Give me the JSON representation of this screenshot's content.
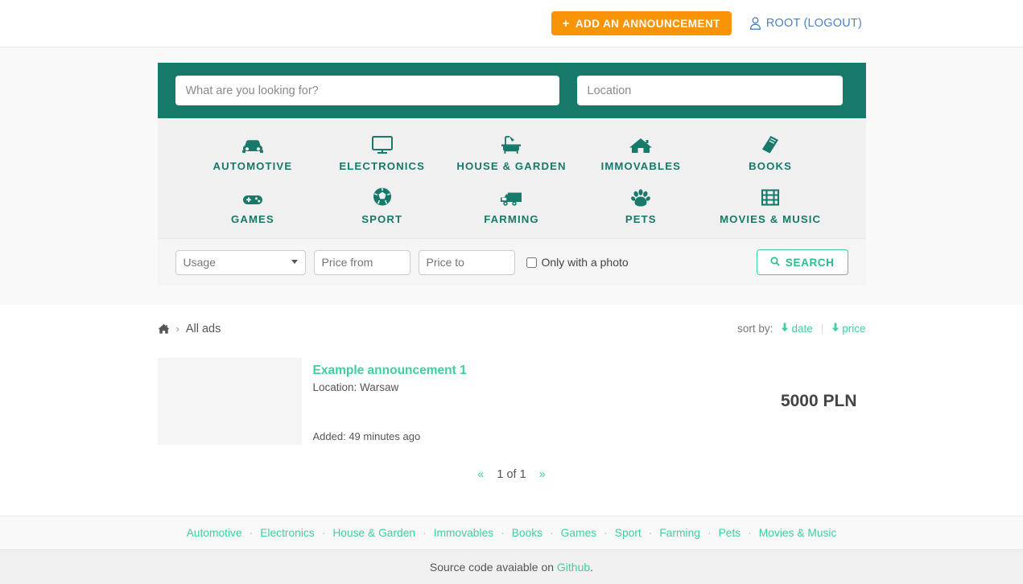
{
  "header": {
    "add_button_label": "ADD AN ANNOUNCEMENT",
    "add_button_plus": "+",
    "user_label": "ROOT (LOGOUT)",
    "user_icon": "user-icon",
    "accent_orange": "#f89406",
    "link_blue": "#4f80c4"
  },
  "search": {
    "query_placeholder": "What are you looking for?",
    "query_value": "",
    "location_placeholder": "Location",
    "location_value": "",
    "band_color": "#17796a"
  },
  "categories": {
    "row1": [
      {
        "label": "AUTOMOTIVE",
        "icon": "car-icon"
      },
      {
        "label": "ELECTRONICS",
        "icon": "monitor-icon"
      },
      {
        "label": "HOUSE & GARDEN",
        "icon": "bathtub-icon"
      },
      {
        "label": "IMMOVABLES",
        "icon": "home-icon"
      },
      {
        "label": "BOOKS",
        "icon": "book-icon"
      }
    ],
    "row2": [
      {
        "label": "GAMES",
        "icon": "gamepad-icon"
      },
      {
        "label": "SPORT",
        "icon": "soccer-ball-icon"
      },
      {
        "label": "FARMING",
        "icon": "truck-icon"
      },
      {
        "label": "PETS",
        "icon": "paw-icon"
      },
      {
        "label": "MOVIES & MUSIC",
        "icon": "film-icon"
      }
    ]
  },
  "filters": {
    "usage_selected": "Usage",
    "usage_options": [
      "Usage"
    ],
    "price_from_placeholder": "Price from",
    "price_from_value": "",
    "price_to_placeholder": "Price to",
    "price_to_value": "",
    "only_photo_label": "Only with a photo",
    "only_photo_checked": false,
    "search_button_label": "SEARCH",
    "search_icon": "magnifier-icon"
  },
  "breadcrumb": {
    "home_icon": "home-icon",
    "separator": "›",
    "current": "All ads"
  },
  "sort": {
    "label": "sort by:",
    "date_label": "date",
    "price_label": "price",
    "arrow_icon": "arrow-down-icon"
  },
  "listings": [
    {
      "title": "Example announcement 1",
      "location": "Location: Warsaw",
      "added": "Added: 49 minutes ago",
      "price": "5000 PLN",
      "thumbnail": "placeholder-thumbnail"
    }
  ],
  "pagination": {
    "prev": "«",
    "current": "1 of 1",
    "next": "»"
  },
  "footer": {
    "links": [
      "Automotive",
      "Electronics",
      "House & Garden",
      "Immovables",
      "Books",
      "Games",
      "Sport",
      "Farming",
      "Pets",
      "Movies & Music"
    ],
    "separator": "·",
    "source_text_before": "Source code avaiable on",
    "source_link": "Github",
    "source_text_after": "."
  }
}
